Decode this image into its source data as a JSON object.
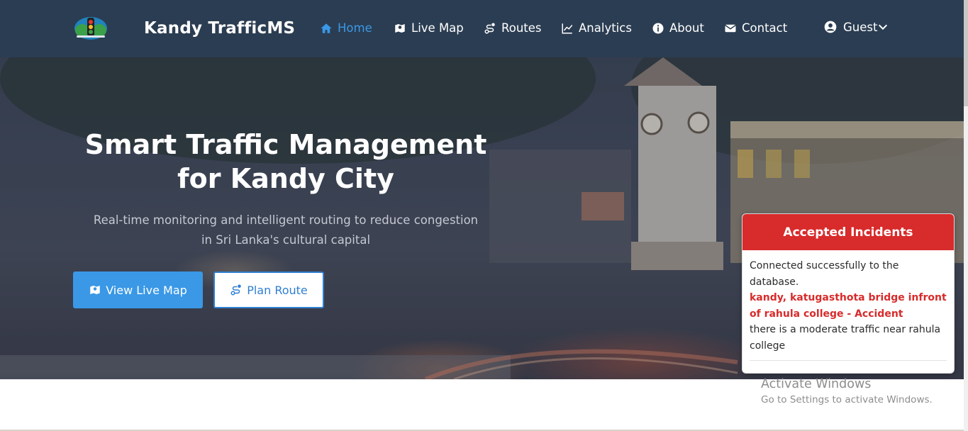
{
  "nav": {
    "brand": "Kandy TrafficMS",
    "items": [
      {
        "label": "Home",
        "icon": "home-icon",
        "active": true
      },
      {
        "label": "Live Map",
        "icon": "map-icon"
      },
      {
        "label": "Routes",
        "icon": "route-icon"
      },
      {
        "label": "Analytics",
        "icon": "chart-line-icon"
      },
      {
        "label": "About",
        "icon": "info-circle-icon"
      },
      {
        "label": "Contact",
        "icon": "envelope-icon"
      }
    ],
    "user": {
      "label": "Guest",
      "icon": "user-circle-icon"
    }
  },
  "hero": {
    "title_line1": "Smart Traffic Management",
    "title_line2": "for Kandy City",
    "subtitle_line1": "Real-time monitoring and intelligent routing to reduce congestion",
    "subtitle_line2": "in Sri Lanka's cultural capital",
    "primary_button": "View Live Map",
    "secondary_button": "Plan Route"
  },
  "incidents": {
    "header": "Accepted Incidents",
    "status": "Connected successfully to the database.",
    "items": [
      {
        "title": "kandy, katugasthota bridge infront of rahula college - Accident",
        "description": "there is a moderate traffic near rahula college"
      }
    ]
  },
  "watermark": {
    "title": "Activate Windows",
    "subtitle": "Go to Settings to activate Windows."
  },
  "colors": {
    "navbar": "#2b3d52",
    "accent": "#3a98e6",
    "incident_red": "#d82b2b"
  }
}
